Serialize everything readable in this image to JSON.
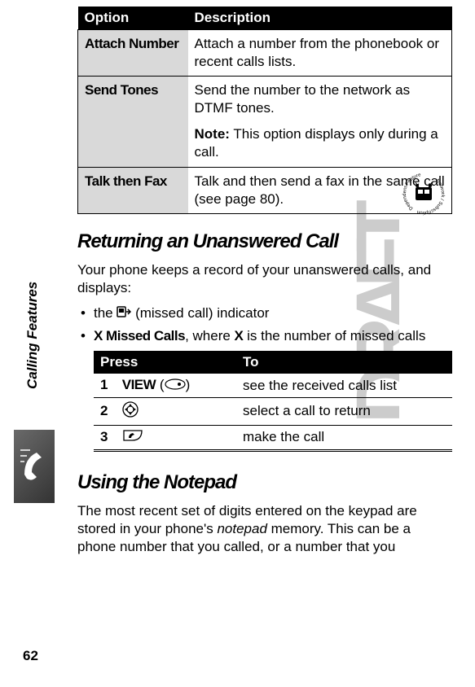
{
  "watermark": "DRAFT",
  "side_label": "Calling Features",
  "page_number": "62",
  "opt_table": {
    "col1": "Option",
    "col2": "Description",
    "rows": [
      {
        "opt": "Attach Number",
        "desc": "Attach a number from the phonebook or recent calls lists."
      },
      {
        "opt": "Send Tones",
        "desc_a": "Send the number to the network as DTMF tones.",
        "desc_b_label": "Note:",
        "desc_b": " This option displays only during a call."
      },
      {
        "opt": "Talk then Fax",
        "desc": "Talk and then send a fax in the same call (see page 80)."
      }
    ]
  },
  "section1": {
    "heading": "Returning an Unanswered Call",
    "intro": "Your phone keeps a record of your unanswered calls, and displays:",
    "bullet1_a": "the ",
    "bullet1_b": " (missed call) indicator",
    "bullet2_a": "X Missed Calls",
    "bullet2_b": ", where ",
    "bullet2_c": "X",
    "bullet2_d": " is the number of missed calls"
  },
  "steps_table": {
    "col1": "Press",
    "col2": "To",
    "rows": [
      {
        "num": "1",
        "press_a": "VIEW",
        "press_b": " (",
        "press_c": ")",
        "to": "see the received calls list"
      },
      {
        "num": "2",
        "to": "select a call to return"
      },
      {
        "num": "3",
        "to": "make the call"
      }
    ]
  },
  "section2": {
    "heading": "Using the Notepad",
    "para_a": "The most recent set of digits entered on the keypad are stored in your phone's ",
    "para_b": "notepad",
    "para_c": " memory. This can be a phone number that you called, or a number that you"
  }
}
